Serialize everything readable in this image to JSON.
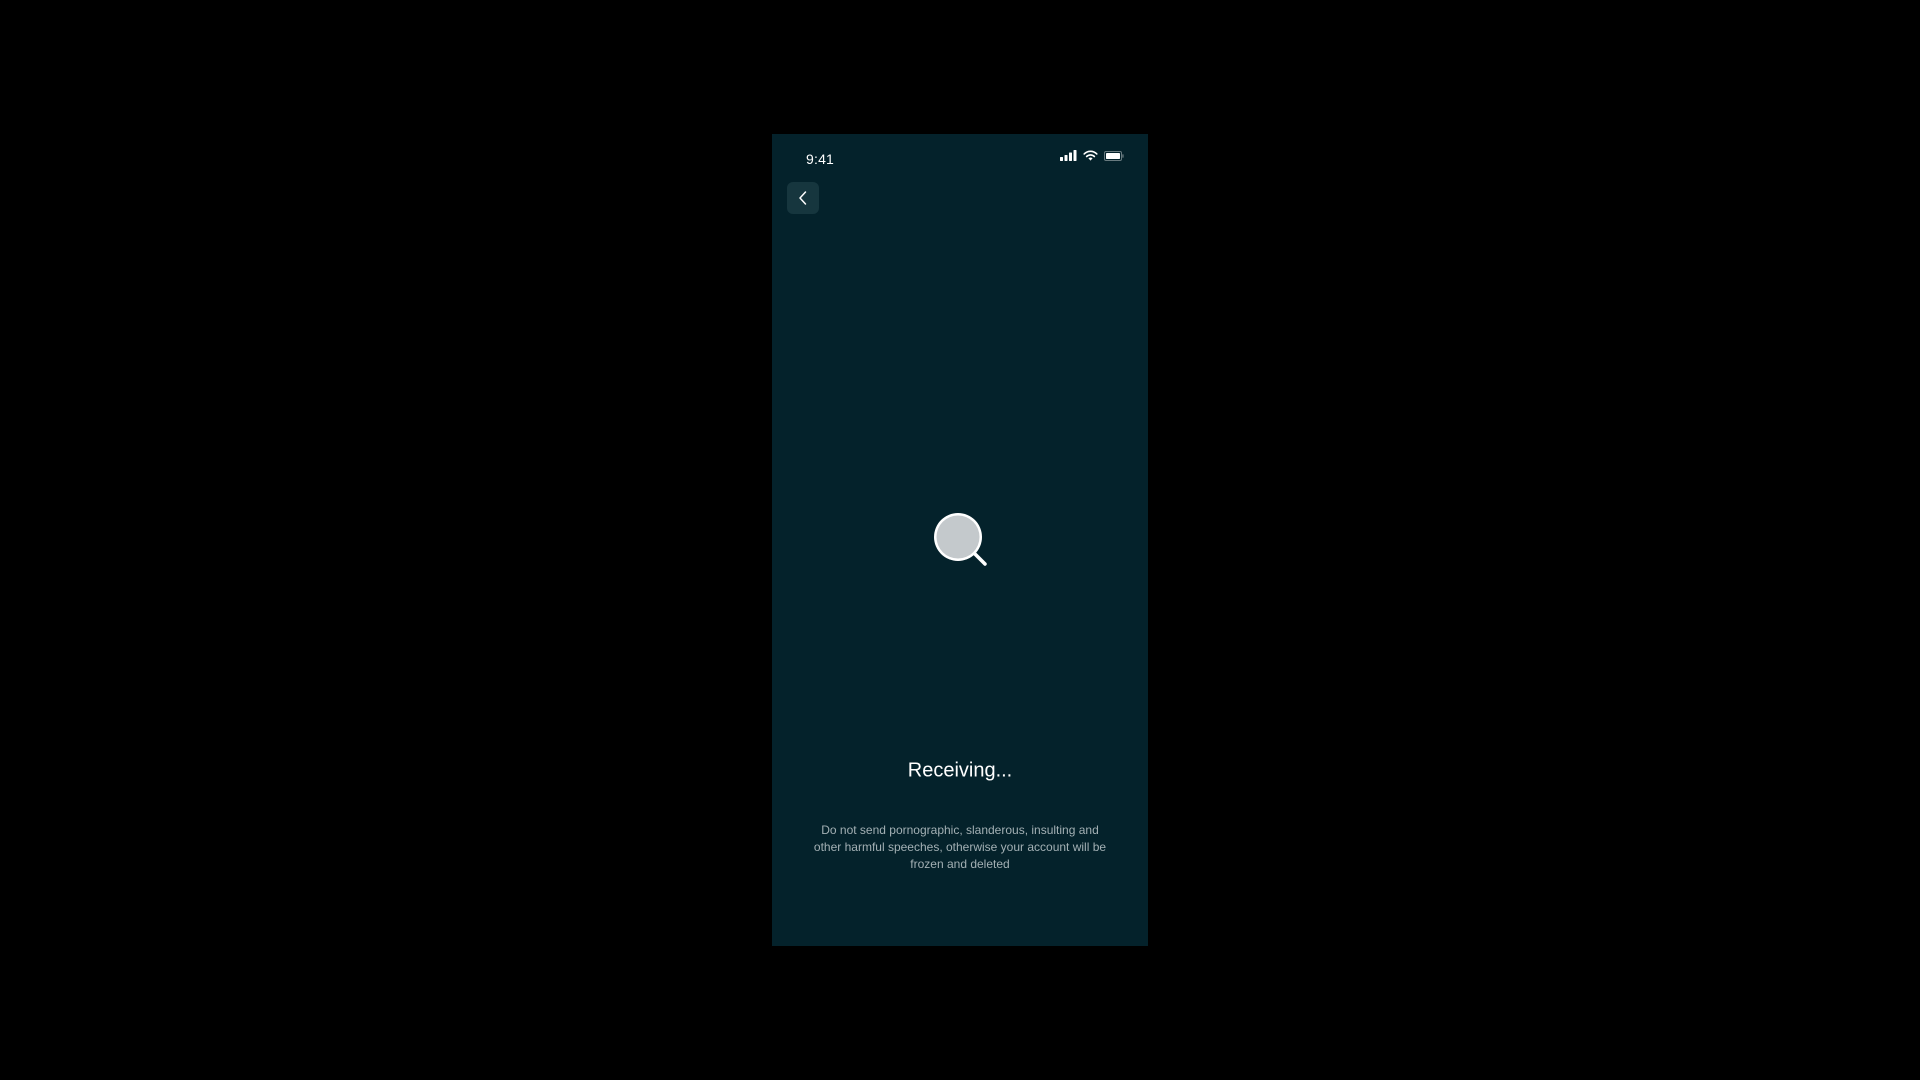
{
  "status_bar": {
    "time": "9:41",
    "icons": [
      "cellular-signal-icon",
      "wifi-icon",
      "battery-icon"
    ]
  },
  "nav": {
    "back_icon": "chevron-left-icon"
  },
  "main": {
    "center_icon": "search-icon",
    "title": "Receiving...",
    "notice": "Do not send pornographic, slanderous, insulting and other harmful speeches, otherwise your account will be frozen and deleted"
  },
  "colors": {
    "page_background": "#000000",
    "screen_background": "#04222b",
    "back_button_background": "#16363e",
    "title_text": "#ffffff",
    "notice_text": "#a3b0b4",
    "search_icon_fill": "#c4c9cc"
  }
}
